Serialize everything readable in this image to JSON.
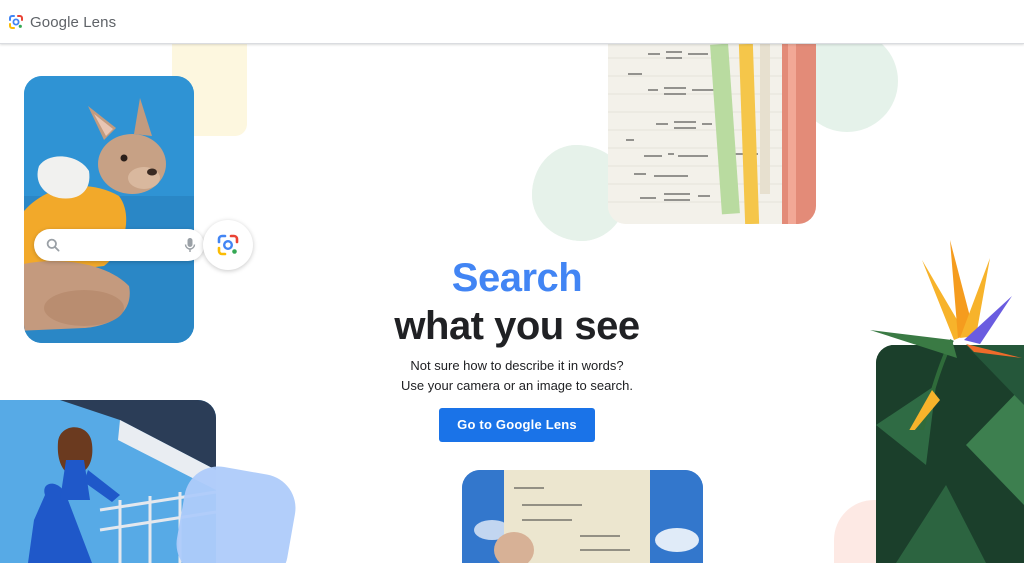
{
  "header": {
    "logo_text": "Google Lens"
  },
  "hero": {
    "title_line1": "Search",
    "title_line2": "what you see",
    "subtitle_line1": "Not sure how to describe it in words?",
    "subtitle_line2": "Use your camera or an image to search.",
    "cta_label": "Go to Google Lens"
  },
  "images": {
    "dog": "french-bulldog-photo",
    "math": "math-notebook-photo",
    "woman": "woman-blue-blazer-photo",
    "korean": "korean-handwritten-note-photo",
    "plant": "bird-of-paradise-flower-photo"
  },
  "icons": {
    "search": "search-icon",
    "mic": "mic-icon",
    "lens": "google-lens-icon"
  },
  "colors": {
    "brand_blue": "#4285f4",
    "button_blue": "#1a73e8",
    "text_dark": "#202124",
    "google_red": "#ea4335",
    "google_yellow": "#fbbc04",
    "google_green": "#34a853"
  }
}
